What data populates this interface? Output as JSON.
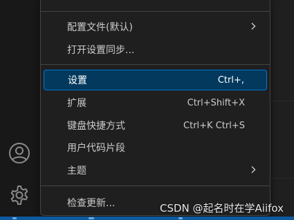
{
  "menu": {
    "items": [
      {
        "label": "配置文件(默认)",
        "shortcut": "",
        "submenu": true
      },
      {
        "label": "打开设置同步...",
        "shortcut": "",
        "submenu": false
      },
      {
        "label": "设置",
        "shortcut": "Ctrl+,",
        "submenu": false,
        "selected": true
      },
      {
        "label": "扩展",
        "shortcut": "Ctrl+Shift+X",
        "submenu": false
      },
      {
        "label": "键盘快捷方式",
        "shortcut": "Ctrl+K Ctrl+S",
        "submenu": false
      },
      {
        "label": "用户代码片段",
        "shortcut": "",
        "submenu": false
      },
      {
        "label": "主题",
        "shortcut": "",
        "submenu": true
      },
      {
        "label": "检查更新...",
        "shortcut": "",
        "submenu": false
      }
    ]
  },
  "activity_bar": {
    "icons": [
      "account-icon",
      "manage-gear-icon"
    ]
  },
  "watermark": "CSDN @起名时在学Aiifox",
  "colors": {
    "accent": "#0078d4",
    "selected_bg": "#04395e",
    "status_bar": "#0e5a9e"
  }
}
